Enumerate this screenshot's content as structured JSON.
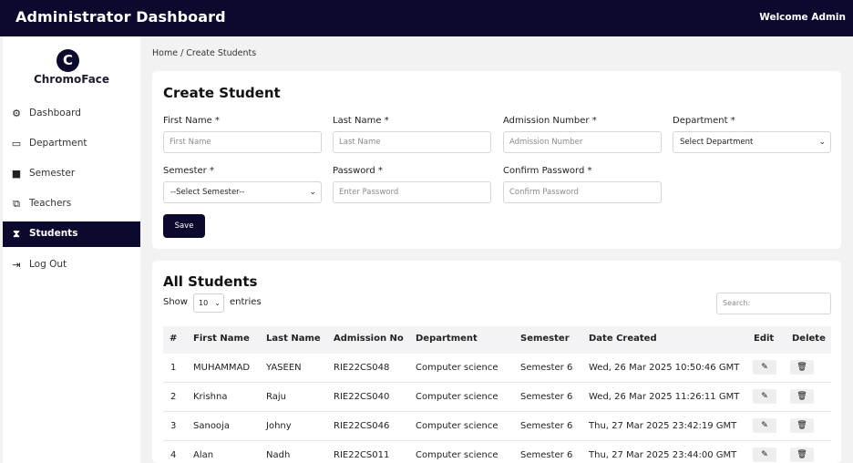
{
  "header": {
    "title": "Administrator Dashboard",
    "welcome": "Welcome Admin"
  },
  "sidebar": {
    "logo_letter": "C",
    "brand": "ChromoFace",
    "items": [
      {
        "label": "Dashboard",
        "icon": "dashboard-icon",
        "glyph": "⚙"
      },
      {
        "label": "Department",
        "icon": "monitor-icon",
        "glyph": "▭"
      },
      {
        "label": "Semester",
        "icon": "book-icon",
        "glyph": "■"
      },
      {
        "label": "Teachers",
        "icon": "chalkboard-teacher-icon",
        "glyph": "⧉"
      },
      {
        "label": "Students",
        "icon": "student-icon",
        "glyph": "⧗",
        "active": true
      },
      {
        "label": "Log Out",
        "icon": "logout-icon",
        "glyph": "⇥"
      }
    ]
  },
  "breadcrumb": "Home / Create Students",
  "form": {
    "title": "Create Student",
    "first_name_label": "First Name *",
    "first_name_placeholder": "First Name",
    "last_name_label": "Last Name *",
    "last_name_placeholder": "Last Name",
    "admission_label": "Admission Number *",
    "admission_placeholder": "Admission Number",
    "department_label": "Department *",
    "department_value": "Select Department",
    "semester_label": "Semester *",
    "semester_value": "--Select Semester--",
    "password_label": "Password *",
    "password_placeholder": "Enter Password",
    "confirm_label": "Confirm Password *",
    "confirm_placeholder": "Confirm Password",
    "save_label": "Save"
  },
  "list": {
    "title": "All Students",
    "show_label": "Show",
    "entries_value": "10",
    "entries_label": "entries",
    "search_placeholder": "Search:",
    "columns": [
      "#",
      "First Name",
      "Last Name",
      "Admission No",
      "Department",
      "Semester",
      "Date Created",
      "Edit",
      "Delete"
    ],
    "rows": [
      {
        "num": "1",
        "first": "MUHAMMAD",
        "last": "YASEEN",
        "adm": "RIE22CS048",
        "dept": "Computer science",
        "sem": "Semester 6",
        "date": "Wed, 26 Mar 2025 10:50:46 GMT"
      },
      {
        "num": "2",
        "first": "Krishna",
        "last": "Raju",
        "adm": "RIE22CS040",
        "dept": "Computer science",
        "sem": "Semester 6",
        "date": "Wed, 26 Mar 2025 11:26:11 GMT"
      },
      {
        "num": "3",
        "first": "Sanooja",
        "last": "Johny",
        "adm": "RIE22CS046",
        "dept": "Computer science",
        "sem": "Semester 6",
        "date": "Thu, 27 Mar 2025 23:42:19 GMT"
      },
      {
        "num": "4",
        "first": "Alan",
        "last": "Nadh",
        "adm": "RIE22CS011",
        "dept": "Computer science",
        "sem": "Semester 6",
        "date": "Thu, 27 Mar 2025 23:44:00 GMT"
      }
    ]
  },
  "colors": {
    "primary": "#0b0a2e",
    "background": "#f2f2f3"
  }
}
